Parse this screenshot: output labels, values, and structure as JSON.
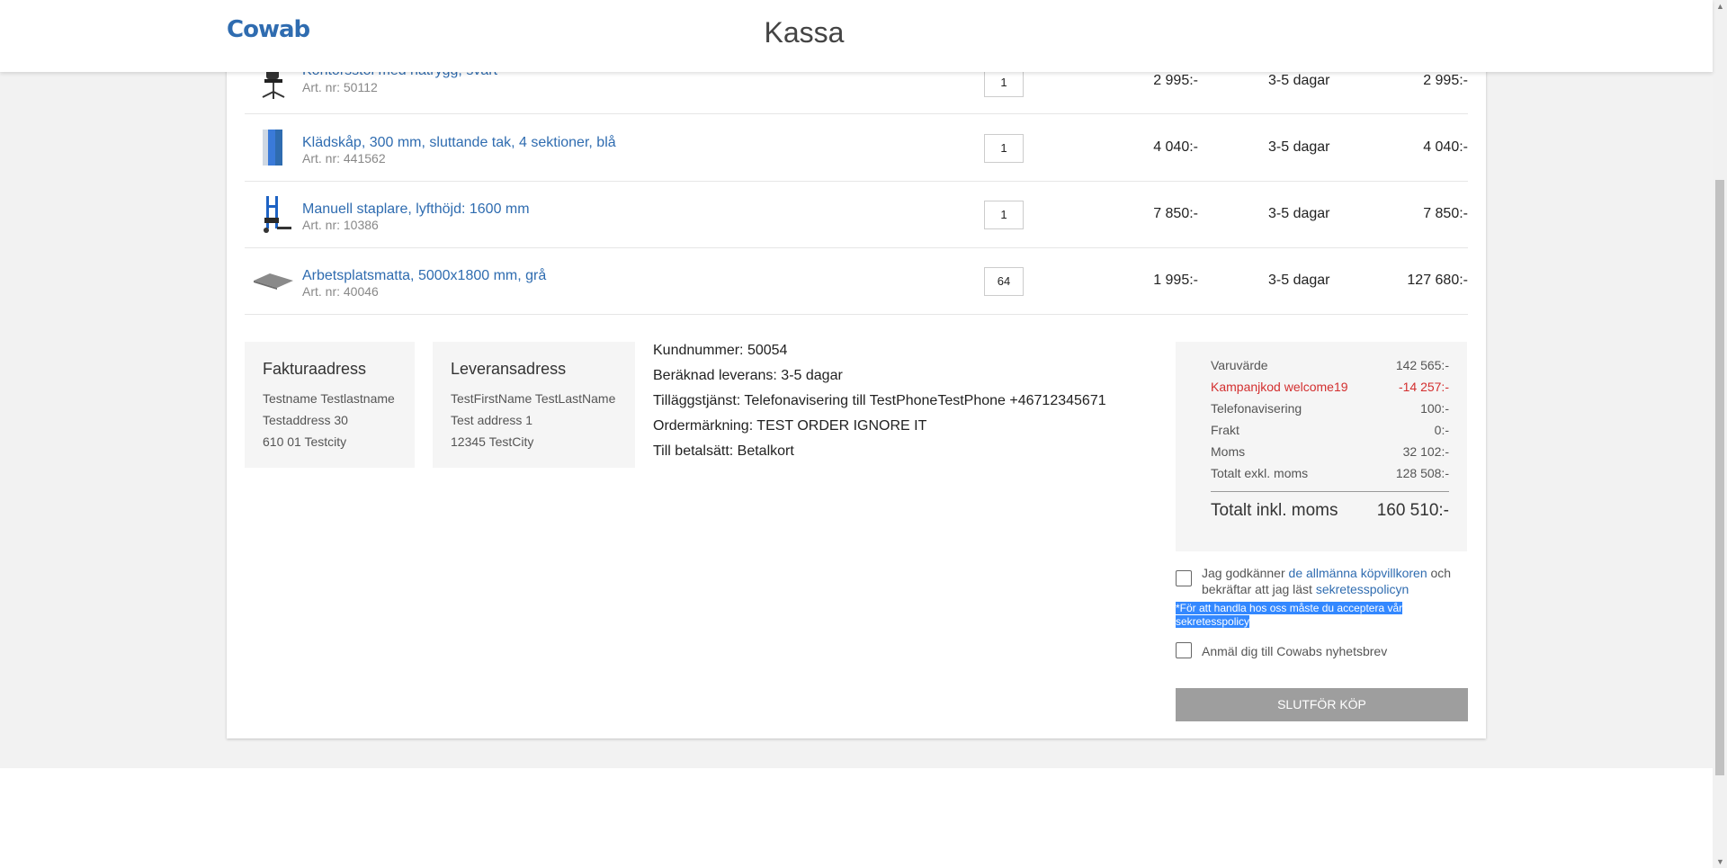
{
  "header": {
    "logo": "Cowab",
    "title": "Kassa"
  },
  "cart": {
    "items": [
      {
        "name": "Kontorsstol med nätrygg, svart",
        "art_nr": "Art. nr: 50112",
        "qty": "1",
        "price": "2 995:-",
        "delivery": "3-5 dagar",
        "total": "2 995:-"
      },
      {
        "name": "Klädskåp, 300 mm, sluttande tak, 4 sektioner, blå",
        "art_nr": "Art. nr: 441562",
        "qty": "1",
        "price": "4 040:-",
        "delivery": "3-5 dagar",
        "total": "4 040:-"
      },
      {
        "name": "Manuell staplare, lyfthöjd: 1600 mm",
        "art_nr": "Art. nr: 10386",
        "qty": "1",
        "price": "7 850:-",
        "delivery": "3-5 dagar",
        "total": "7 850:-"
      },
      {
        "name": "Arbetsplatsmatta, 5000x1800 mm, grå",
        "art_nr": "Art. nr: 40046",
        "qty": "64",
        "price": "1 995:-",
        "delivery": "3-5 dagar",
        "total": "127 680:-"
      }
    ]
  },
  "billing": {
    "title": "Fakturaadress",
    "lines": [
      "Testname Testlastname",
      "Testaddress 30",
      "610 01 Testcity"
    ]
  },
  "shipping": {
    "title": "Leveransadress",
    "lines": [
      "TestFirstName TestLastName",
      "Test address 1",
      "12345 TestCity"
    ]
  },
  "order_info": {
    "customer_number": "Kundnummer: 50054",
    "estimated_delivery": "Beräknad leverans: 3-5 dagar",
    "extra_service": "Tilläggstjänst: Telefonavisering till TestPhoneTestPhone +46712345671",
    "order_marking": "Ordermärkning: TEST ORDER IGNORE IT",
    "payment_method": "Till betalsätt: Betalkort"
  },
  "summary": {
    "goods_label": "Varuvärde",
    "goods_value": "142 565:-",
    "campaign_label": "Kampanjkod welcome19",
    "campaign_value": "-14 257:-",
    "phone_label": "Telefonavisering",
    "phone_value": "100:-",
    "freight_label": "Frakt",
    "freight_value": "0:-",
    "vat_label": "Moms",
    "vat_value": "32 102:-",
    "excl_label": "Totalt exkl. moms",
    "excl_value": "128 508:-",
    "incl_label": "Totalt inkl. moms",
    "incl_value": "160 510:-",
    "accent_color": "#d32f2f"
  },
  "terms": {
    "prefix": "Jag godkänner ",
    "terms_link": "de allmänna köpvillkoren",
    "middle": " och bekräftar att jag läst ",
    "privacy_link": "sekretesspolicyn",
    "note": "*För att handla hos oss måste du acceptera vår sekretesspolicy",
    "newsletter": "Anmäl dig till Cowabs nyhetsbrev"
  },
  "submit_label": "SLUTFÖR KÖP",
  "colors": {
    "brand": "#2f6cb0",
    "button": "#9e9e9e",
    "selection": "#3388ff"
  }
}
